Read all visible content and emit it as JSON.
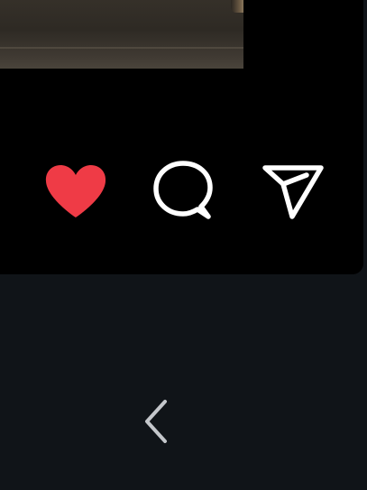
{
  "post_actions": {
    "like": {
      "icon": "heart-icon",
      "state": "liked",
      "color": "#EF3B46"
    },
    "comment": {
      "icon": "comment-bubble-icon",
      "color": "#FFFFFF"
    },
    "share": {
      "icon": "paper-plane-icon",
      "color": "#FFFFFF"
    }
  },
  "navigation": {
    "back": {
      "icon": "chevron-left-icon",
      "color": "#C4C7CB"
    }
  },
  "theme": {
    "card_background": "#000000",
    "page_background": "#101418"
  }
}
